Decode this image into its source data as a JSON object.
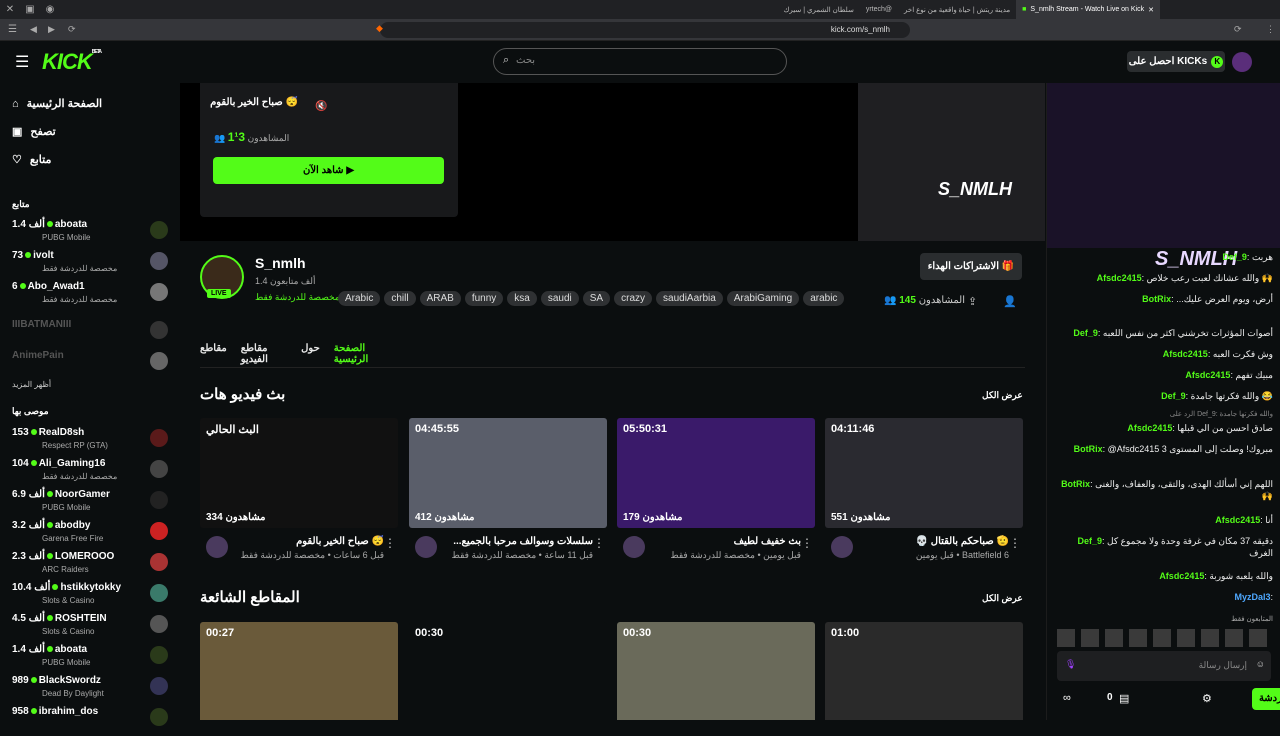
{
  "browser": {
    "tabs": [
      {
        "label": "S_nmlh Stream - Watch Live on Kick",
        "active": true
      },
      {
        "label": "مدينة ريتش | حياة واقعية من نوع اخر"
      },
      {
        "label": "yrtech@"
      },
      {
        "label": "سلطان الشمري | سيرك"
      }
    ],
    "url": "kick.com/s_nmlh"
  },
  "header": {
    "logo": "KICK",
    "logo_badge": "BETA",
    "search_placeholder": "بحث",
    "get_kicks": "احصل على KICKs"
  },
  "sidebar": {
    "nav": [
      {
        "label": "الصفحة الرئيسية",
        "icon": "home-icon"
      },
      {
        "label": "تصفح",
        "icon": "browse-icon"
      },
      {
        "label": "متابع",
        "icon": "heart-icon"
      }
    ],
    "following_title": "متابع",
    "following": [
      {
        "name": "aboata",
        "count": "1.4 ألف",
        "game": "PUBG Mobile",
        "live": true
      },
      {
        "name": "ivolt",
        "count": "73",
        "game": "مخصصة للدردشة فقط",
        "live": true
      },
      {
        "name": "Abo_Awad1",
        "count": "6",
        "game": "مخصصة للدردشة فقط",
        "live": true
      },
      {
        "name": "IIIBATMANIII",
        "count": "",
        "game": "",
        "live": false
      },
      {
        "name": "AnimePain",
        "count": "",
        "game": "",
        "live": false
      }
    ],
    "show_more": "أظهر المزيد",
    "recommended_title": "موصى بها",
    "recommended": [
      {
        "name": "RealD8sh",
        "count": "153",
        "game": "Respect RP (GTA)"
      },
      {
        "name": "Ali_Gaming16",
        "count": "104",
        "game": "مخصصة للدردشة فقط"
      },
      {
        "name": "NoorGamer",
        "count": "6.9 ألف",
        "game": "PUBG Mobile"
      },
      {
        "name": "abodby",
        "count": "3.2 ألف",
        "game": "Garena Free Fire"
      },
      {
        "name": "LOMEROOO",
        "count": "2.3 ألف",
        "game": "ARC Raiders"
      },
      {
        "name": "hstikkytokky",
        "count": "10.4 ألف",
        "game": "Slots & Casino"
      },
      {
        "name": "ROSHTEIN",
        "count": "4.5 ألف",
        "game": "Slots & Casino"
      },
      {
        "name": "aboata",
        "count": "1.4 ألف",
        "game": "PUBG Mobile"
      },
      {
        "name": "BlackSwordz",
        "count": "989",
        "game": "Dead By Daylight"
      },
      {
        "name": "ibrahim_dos",
        "count": "958",
        "game": ""
      }
    ]
  },
  "offline_card": {
    "title": "صباح الخير بالقوم 😴",
    "viewers_label": "المشاهدون",
    "viewers": "1¹3",
    "watch_now": "شاهد الآن ▶"
  },
  "channel": {
    "name": "S_nmlh",
    "followers": "1.4 ألف متابعون",
    "category": "مخصصة للدردشة فقط",
    "live_badge": "LIVE",
    "tags": [
      "Arabic",
      "chill",
      "ARAB",
      "funny",
      "ksa",
      "saudi",
      "SA",
      "crazy",
      "saudiAarbia",
      "ArabiGaming",
      "arabic"
    ],
    "viewers_label": "المشاهدون",
    "viewers": "145",
    "gift_subs": "الاشتراكات الهداء",
    "tabs": [
      "الصفحة الرئيسية",
      "حول",
      "مقاطع الفيديو",
      "مقاطع"
    ]
  },
  "videos": {
    "title": "بث فيديو هات",
    "view_all": "عرض الكل",
    "items": [
      {
        "duration": "البث الحالي",
        "views": "334 مشاهدون",
        "title": "صباح الخير بالقوم 😴",
        "meta": "قبل 6 ساعات • مخصصة للدردشة فقط"
      },
      {
        "duration": "04:45:55",
        "views": "412 مشاهدون",
        "title": "...سلسلات وسوالف مرحبا بالجميع",
        "meta": "قبل 11 ساعة • مخصصة للدردشة فقط"
      },
      {
        "duration": "05:50:31",
        "views": "179 مشاهدون",
        "title": "بث خفيف لطيف",
        "meta": "قبل يومين • مخصصة للدردشة فقط"
      },
      {
        "duration": "04:11:46",
        "views": "551 مشاهدون",
        "title": "💀 صباحكم بالقتال 🫡",
        "meta": "قبل يومين • Battlefield 6"
      }
    ]
  },
  "clips": {
    "title": "المقاطع الشائعة",
    "view_all": "عرض الكل",
    "items": [
      {
        "duration": "00:27"
      },
      {
        "duration": "00:30"
      },
      {
        "duration": "00:30"
      },
      {
        "duration": "01:00"
      }
    ]
  },
  "chat": {
    "cam_name": "S_NMLH",
    "messages": [
      {
        "user": "Def_9",
        "text": "هربت"
      },
      {
        "user": "Afsdc2415",
        "text": "والله عشانك لعبت رعب خلاص 🙌"
      },
      {
        "user": "BotRix",
        "text": "...أرض، ويوم العرض عليك",
        "bot": true
      },
      {
        "user": "Def_9",
        "text": "أصوات المؤثرات تخرشني اكثر من نفس اللعبه"
      },
      {
        "user": "Afsdc2415",
        "text": "وش فكرت العبه"
      },
      {
        "user": "Afsdc2415",
        "text": "مبيك تفهم"
      },
      {
        "user": "Def_9",
        "text": "والله فكرتها جامدة 😂"
      },
      {
        "user": "Afsdc2415",
        "text": "صادق احسن من الي قبلها"
      },
      {
        "user": "BotRix",
        "text": "@Afsdc2415 مبروك! وصلت إلى المستوى 3",
        "bot": true
      },
      {
        "user": "BotRix",
        "text": "اللهم إني أسألك الهدى، والتقى، والعفاف، والغنى 🙌",
        "bot": true
      },
      {
        "user": "Afsdc2415",
        "text": "أنا"
      },
      {
        "user": "Def_9",
        "text": "دقيقه 37 مكان في غرفة وحدة ولا مجموع كل الغرف"
      },
      {
        "user": "Afsdc2415",
        "text": "والله يلعبه شوربة"
      },
      {
        "user": "MyzDal3",
        "text": ""
      }
    ],
    "reply_hint": "الرد على Def_9: والله فكرتها جامدة",
    "followers_only": "المتابعون فقط",
    "input_placeholder": "إرسال رسالة",
    "send_label": "الدردشة",
    "points": "0"
  },
  "colors": {
    "accent": "#53fc18",
    "bg": "#0b0e0f",
    "card": "#18191b"
  }
}
